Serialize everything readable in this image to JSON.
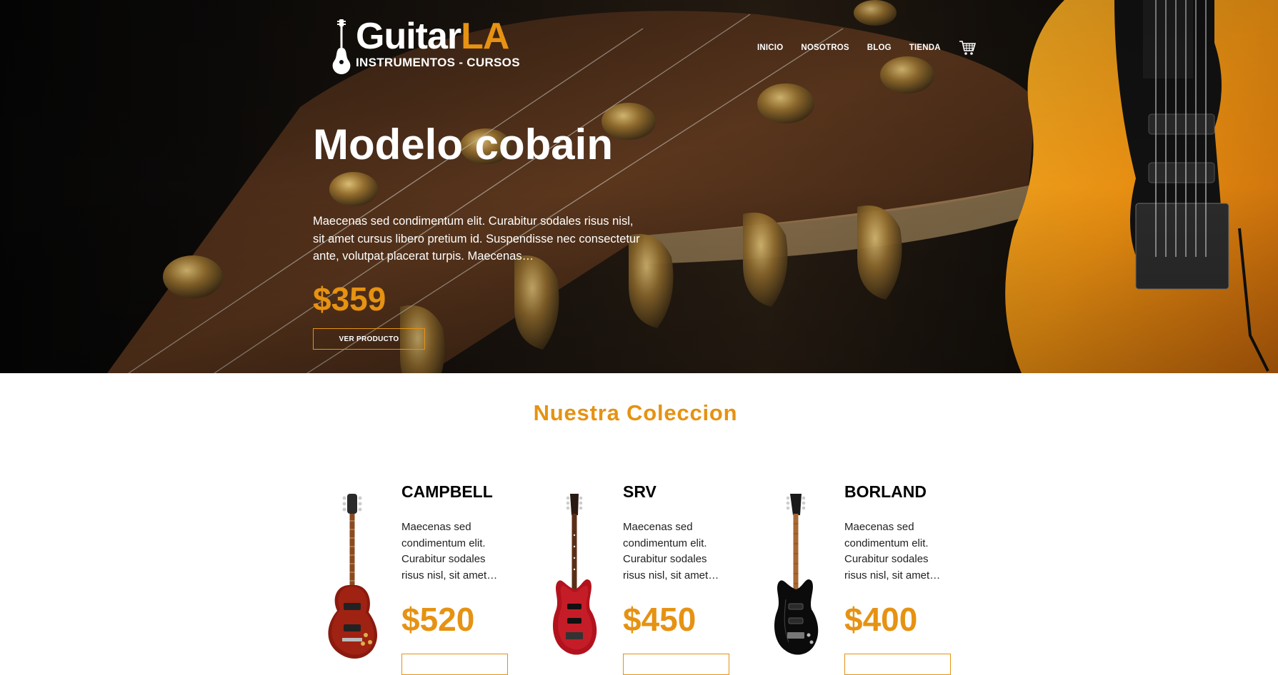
{
  "header": {
    "logo": {
      "name_main": "Guitar",
      "name_accent": "LA",
      "subtitle": "INSTRUMENTOS - CURSOS"
    },
    "nav": [
      {
        "label": "INICIO"
      },
      {
        "label": "NOSOTROS"
      },
      {
        "label": "BLOG"
      },
      {
        "label": "TIENDA"
      }
    ],
    "cart_icon": "cart-icon"
  },
  "hero": {
    "title": "Modelo cobain",
    "description": "Maecenas sed condimentum elit. Curabitur sodales risus nisl, sit amet cursus libero pretium id. Suspendisse nec consectetur ante, volutpat placerat turpis. Maecenas…",
    "price": "$359",
    "button_label": "VER PRODUCTO"
  },
  "collection": {
    "title": "Nuestra Coleccion",
    "products": [
      {
        "name": "CAMPBELL",
        "description": "Maecenas sed condimentum elit. Curabitur sodales risus nisl, sit amet…",
        "price": "$520",
        "image": "red-les-paul-guitar"
      },
      {
        "name": "SRV",
        "description": "Maecenas sed condimentum elit. Curabitur sodales risus nisl, sit amet…",
        "price": "$450",
        "image": "red-strat-guitar"
      },
      {
        "name": "BORLAND",
        "description": "Maecenas sed condimentum elit. Curabitur sodales risus nisl, sit amet…",
        "price": "$400",
        "image": "black-strat-guitar"
      }
    ]
  },
  "colors": {
    "accent": "#e69212",
    "hero_text": "#ffffff",
    "body_text": "#000000"
  }
}
